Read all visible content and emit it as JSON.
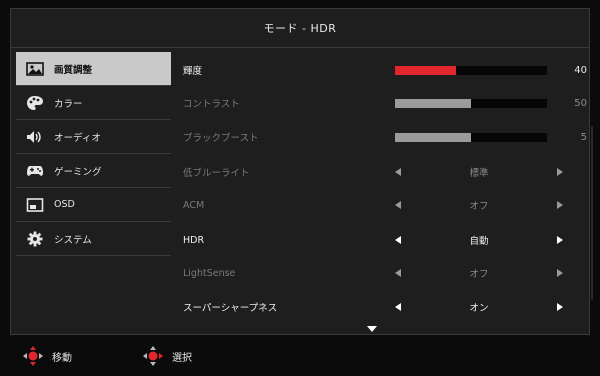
{
  "header": {
    "title": "モード - HDR"
  },
  "sidebar": {
    "items": [
      {
        "label": "画質調整",
        "icon": "picture-icon",
        "active": true
      },
      {
        "label": "カラー",
        "icon": "palette-icon",
        "active": false
      },
      {
        "label": "オーディオ",
        "icon": "speaker-icon",
        "active": false
      },
      {
        "label": "ゲーミング",
        "icon": "gamepad-icon",
        "active": false
      },
      {
        "label": "OSD",
        "icon": "osd-window-icon",
        "active": false
      },
      {
        "label": "システム",
        "icon": "gear-icon",
        "active": false
      }
    ]
  },
  "settings": {
    "brightness": {
      "label": "輝度",
      "value": "40",
      "level_percent": 40,
      "accent": "#e1262e"
    },
    "contrast": {
      "label": "コントラスト",
      "value": "50",
      "level_percent": 50
    },
    "black_boost": {
      "label": "ブラックブースト",
      "value": "5",
      "level_percent": 50
    },
    "blue_light": {
      "label": "低ブルーライト",
      "value": "標準"
    },
    "acm": {
      "label": "ACM",
      "value": "オフ"
    },
    "hdr": {
      "label": "HDR",
      "value": "自動"
    },
    "lightsense": {
      "label": "LightSense",
      "value": "オフ"
    },
    "super_sharpness": {
      "label": "スーパーシャープネス",
      "value": "オン"
    }
  },
  "footer": {
    "move_label": "移動",
    "select_label": "選択"
  },
  "colors": {
    "accent_red": "#e1262e",
    "panel_bg": "#1e1e1e",
    "active_item_bg": "#c9c9c9"
  }
}
